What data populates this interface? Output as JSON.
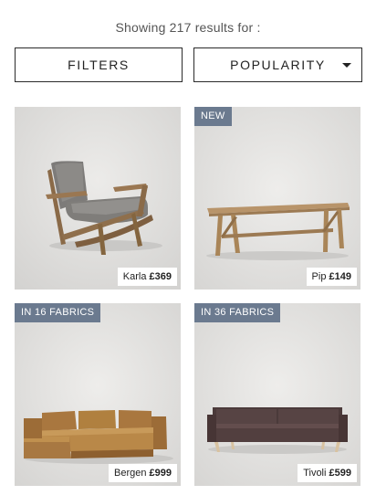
{
  "results_text": "Showing 217 results for :",
  "toolbar": {
    "filters_label": "FILTERS",
    "sort_label": "POPULARITY"
  },
  "products": [
    {
      "name": "Karla",
      "price": "£369",
      "badge": "",
      "image": "armchair"
    },
    {
      "name": "Pip",
      "price": "£149",
      "badge": "NEW",
      "image": "bench"
    },
    {
      "name": "Bergen",
      "price": "£999",
      "badge": "IN 16 FABRICS",
      "image": "corner-sofa"
    },
    {
      "name": "Tivoli",
      "price": "£599",
      "badge": "IN 36 FABRICS",
      "image": "sofa"
    }
  ],
  "colors": {
    "badge_bg": "#6b7a8f",
    "card_bg": "#e1e0de",
    "border": "#2b2b2b"
  }
}
